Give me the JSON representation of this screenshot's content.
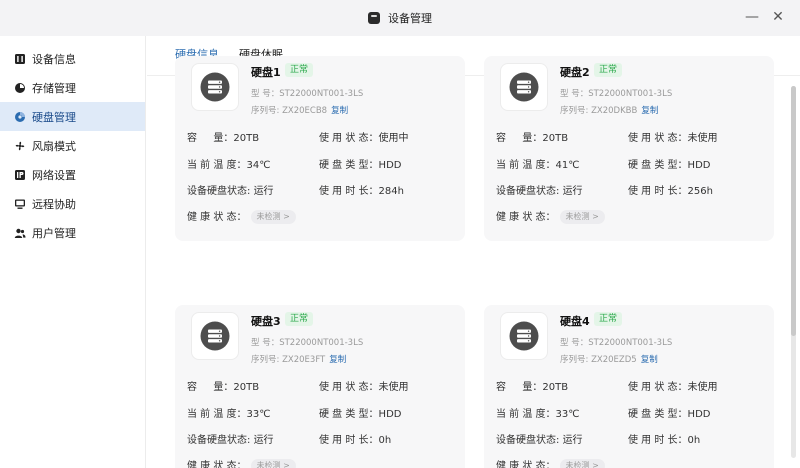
{
  "window": {
    "title": "设备管理",
    "minimize_icon": "minimize-icon",
    "close_icon": "close-icon"
  },
  "sidebar": {
    "items": [
      {
        "label": "设备信息",
        "icon": "device-info-icon"
      },
      {
        "label": "存储管理",
        "icon": "storage-pie-icon"
      },
      {
        "label": "硬盘管理",
        "icon": "disk-management-icon",
        "active": true
      },
      {
        "label": "风扇模式",
        "icon": "fan-icon"
      },
      {
        "label": "网络设置",
        "icon": "network-ip-icon"
      },
      {
        "label": "远程协助",
        "icon": "remote-monitor-icon"
      },
      {
        "label": "用户管理",
        "icon": "users-icon"
      }
    ]
  },
  "tabs": [
    {
      "label": "硬盘信息",
      "active": true
    },
    {
      "label": "硬盘休眠",
      "active": false
    }
  ],
  "labels": {
    "model": "型 号：",
    "serial": "序列号:",
    "copy": "复制",
    "capacity": "容 　 量：",
    "usage_status": "使 用 状 态：",
    "temperature": "当 前 温 度：",
    "disk_type": "硬 盘 类 型：",
    "device_disk_status": "设备硬盘状态:",
    "usage_time": "使 用 时 长：",
    "health": "健 康 状 态：",
    "not_checked": "未检测 >"
  },
  "colors": {
    "accent": "#2b6cb0",
    "status_green": "#2aa84a",
    "status_green_bg": "#e4f5e8"
  },
  "disks": [
    {
      "name": "硬盘1",
      "status": "正常",
      "model": "ST22000NT001-3LS",
      "serial": "ZX20ECB8",
      "capacity": "20TB",
      "usage_status": "使用中",
      "temperature": "34℃",
      "disk_type": "HDD",
      "device_status": "运行",
      "usage_time": "284h"
    },
    {
      "name": "硬盘2",
      "status": "正常",
      "model": "ST22000NT001-3LS",
      "serial": "ZX20DKBB",
      "capacity": "20TB",
      "usage_status": "未使用",
      "temperature": "41℃",
      "disk_type": "HDD",
      "device_status": "运行",
      "usage_time": "256h"
    },
    {
      "name": "硬盘3",
      "status": "正常",
      "model": "ST22000NT001-3LS",
      "serial": "ZX20E3FT",
      "capacity": "20TB",
      "usage_status": "未使用",
      "temperature": "33℃",
      "disk_type": "HDD",
      "device_status": "运行",
      "usage_time": "0h"
    },
    {
      "name": "硬盘4",
      "status": "正常",
      "model": "ST22000NT001-3LS",
      "serial": "ZX20EZD5",
      "capacity": "20TB",
      "usage_status": "未使用",
      "temperature": "33℃",
      "disk_type": "HDD",
      "device_status": "运行",
      "usage_time": "0h"
    }
  ]
}
